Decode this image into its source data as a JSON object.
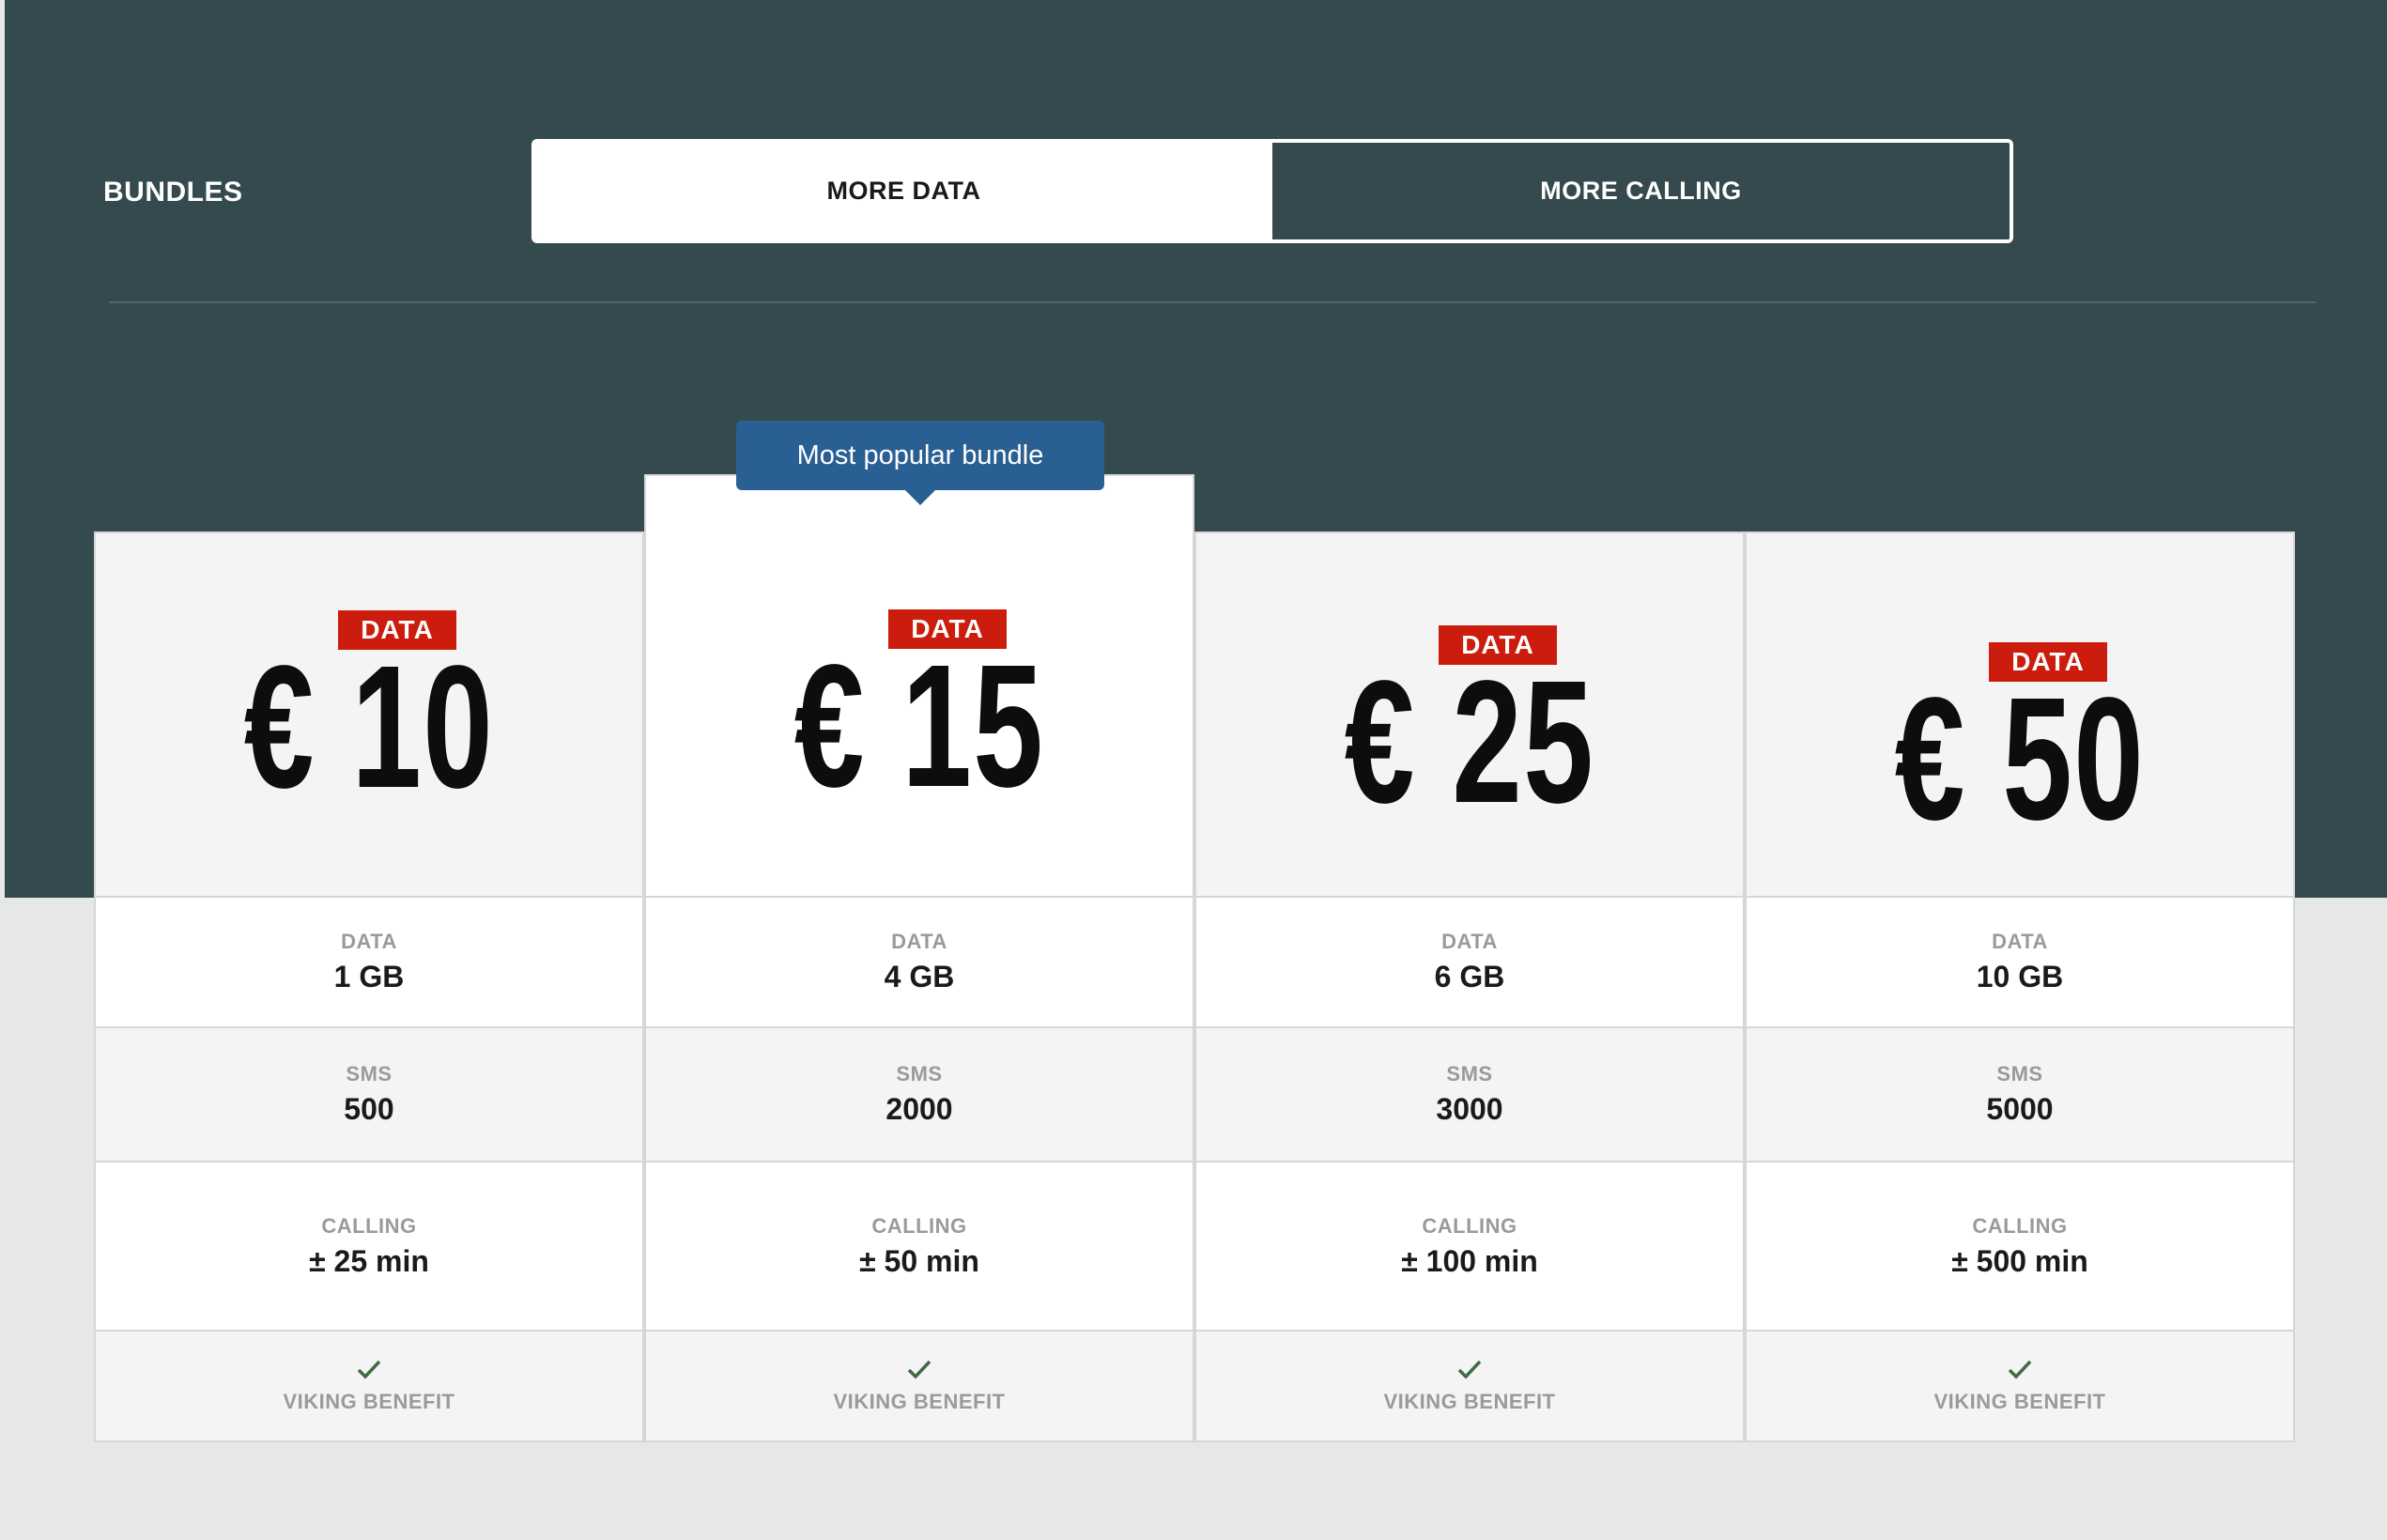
{
  "header": {
    "title": "BUNDLES"
  },
  "toggle": {
    "options": [
      {
        "label": "MORE DATA",
        "active": true
      },
      {
        "label": "MORE CALLING",
        "active": false
      }
    ]
  },
  "featured_tooltip": "Most popular bundle",
  "labels": {
    "data": "DATA",
    "sms": "SMS",
    "calling": "CALLING",
    "benefit": "VIKING BENEFIT"
  },
  "bundles": [
    {
      "badge": "DATA",
      "price": "€ 10",
      "data": "1 GB",
      "sms": "500",
      "calling": "± 25 min",
      "benefit": true
    },
    {
      "badge": "DATA",
      "price": "€ 15",
      "data": "4 GB",
      "sms": "2000",
      "calling": "± 50 min",
      "benefit": true
    },
    {
      "badge": "DATA",
      "price": "€ 25",
      "data": "6 GB",
      "sms": "3000",
      "calling": "± 100 min",
      "benefit": true
    },
    {
      "badge": "DATA",
      "price": "€ 50",
      "data": "10 GB",
      "sms": "5000",
      "calling": "± 500 min",
      "benefit": true
    }
  ],
  "colors": {
    "hero_bg": "#354a4e",
    "badge_red": "#cc1c0d",
    "tooltip_blue": "#2a5f94",
    "check_green": "#3f6b45"
  },
  "icons": {
    "benefit": "check-icon"
  }
}
